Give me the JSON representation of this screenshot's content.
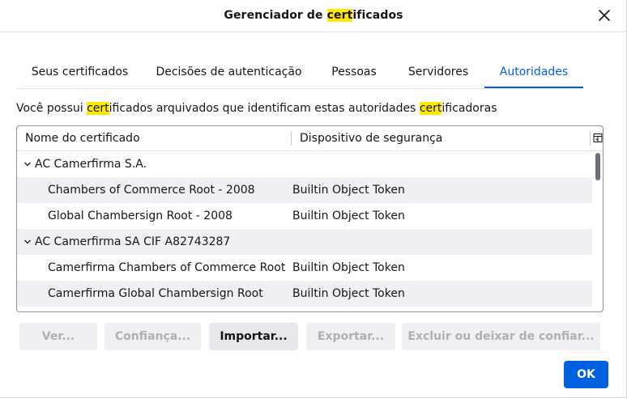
{
  "dialog": {
    "title_prefix": "Gerenciador de ",
    "title_highlight": "cert",
    "title_suffix": "ificados"
  },
  "tabs": [
    {
      "label": "Seus certificados",
      "selected": false
    },
    {
      "label": "Decisões de autenticação",
      "selected": false
    },
    {
      "label": "Pessoas",
      "selected": false
    },
    {
      "label": "Servidores",
      "selected": false
    },
    {
      "label": "Autoridades",
      "selected": true
    }
  ],
  "description": {
    "part1": "Você possui ",
    "hl1": "cert",
    "part2": "ificados arquivados que identificam estas autoridades ",
    "hl2": "cert",
    "part3": "ificadoras"
  },
  "tree": {
    "columns": [
      "Nome do certificado",
      "Dispositivo de segurança"
    ],
    "rows": [
      {
        "type": "group",
        "name": "AC Camerfirma S.A.",
        "device": ""
      },
      {
        "type": "item",
        "name": "Chambers of Commerce Root - 2008",
        "device": "Builtin Object Token"
      },
      {
        "type": "item",
        "name": "Global Chambersign Root - 2008",
        "device": "Builtin Object Token"
      },
      {
        "type": "group",
        "name": "AC Camerfirma SA CIF A82743287",
        "device": ""
      },
      {
        "type": "item",
        "name": "Camerfirma Chambers of Commerce Root",
        "device": "Builtin Object Token"
      },
      {
        "type": "item",
        "name": "Camerfirma Global Chambersign Root",
        "device": "Builtin Object Token"
      }
    ]
  },
  "buttons": {
    "view": "Ver...",
    "trust": "Confiança...",
    "import": "Importar...",
    "export": "Exportar...",
    "delete": "Excluir ou deixar de confiar..."
  },
  "ok_label": "OK",
  "colors": {
    "accent": "#0061e0",
    "highlight": "#ffe900"
  }
}
